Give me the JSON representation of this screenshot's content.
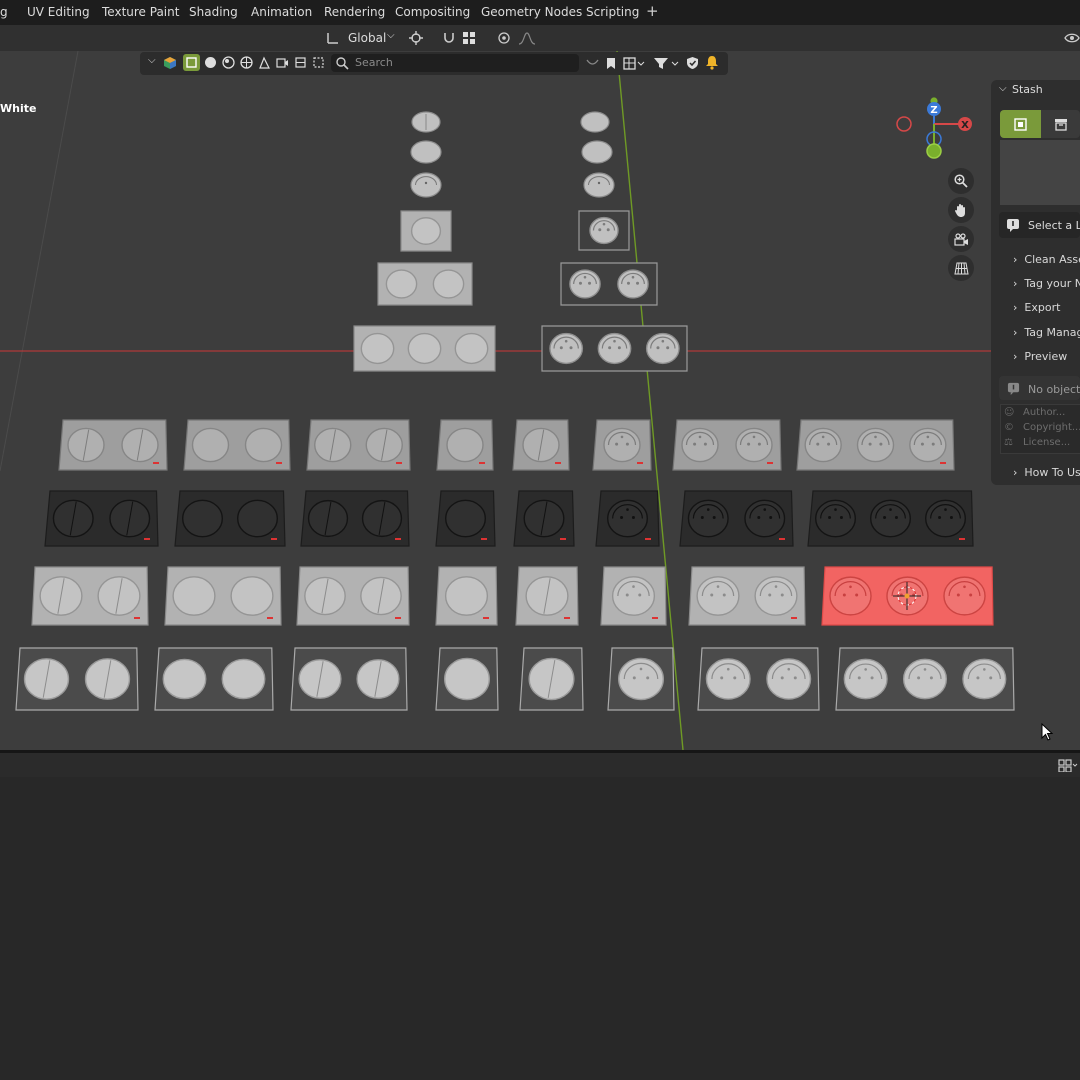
{
  "workspace_tabs": [
    "g",
    "UV Editing",
    "Texture Paint",
    "Shading",
    "Animation",
    "Rendering",
    "Compositing",
    "Geometry Nodes",
    "Scripting"
  ],
  "add_tab_label": "+",
  "header": {
    "orientation": "Global",
    "search_placeholder": "Search"
  },
  "viewport": {
    "object_label": "White",
    "axis_labels": {
      "z": "Z",
      "x": "X"
    },
    "grid_colors": {
      "x_axis": "#b03a3a",
      "y_axis": "#6f9a25"
    },
    "selected_color": "#f26462"
  },
  "stash_panel": {
    "title": "Stash",
    "select_prompt": "Select a Li",
    "sections": [
      "Clean Asse",
      "Tag your N",
      "Export",
      "Tag Manag",
      "Preview"
    ],
    "no_objects": "No objects",
    "fields": [
      "Author...",
      "Copyright...",
      "License..."
    ],
    "how_to": "How To Us"
  },
  "icons": {
    "transform": "transform-orientation-icon",
    "pivot": "pivot-icon",
    "snap": "snap-icon",
    "proportional": "proportional-edit-icon",
    "search": "search-icon",
    "zoom": "zoom-icon",
    "pan": "hand-icon",
    "camera": "camera-icon",
    "grid": "grid-perspective-icon",
    "visibility": "eye-icon",
    "editor_type": "editor-type-icon",
    "cursor": "mouse-cursor-icon"
  }
}
